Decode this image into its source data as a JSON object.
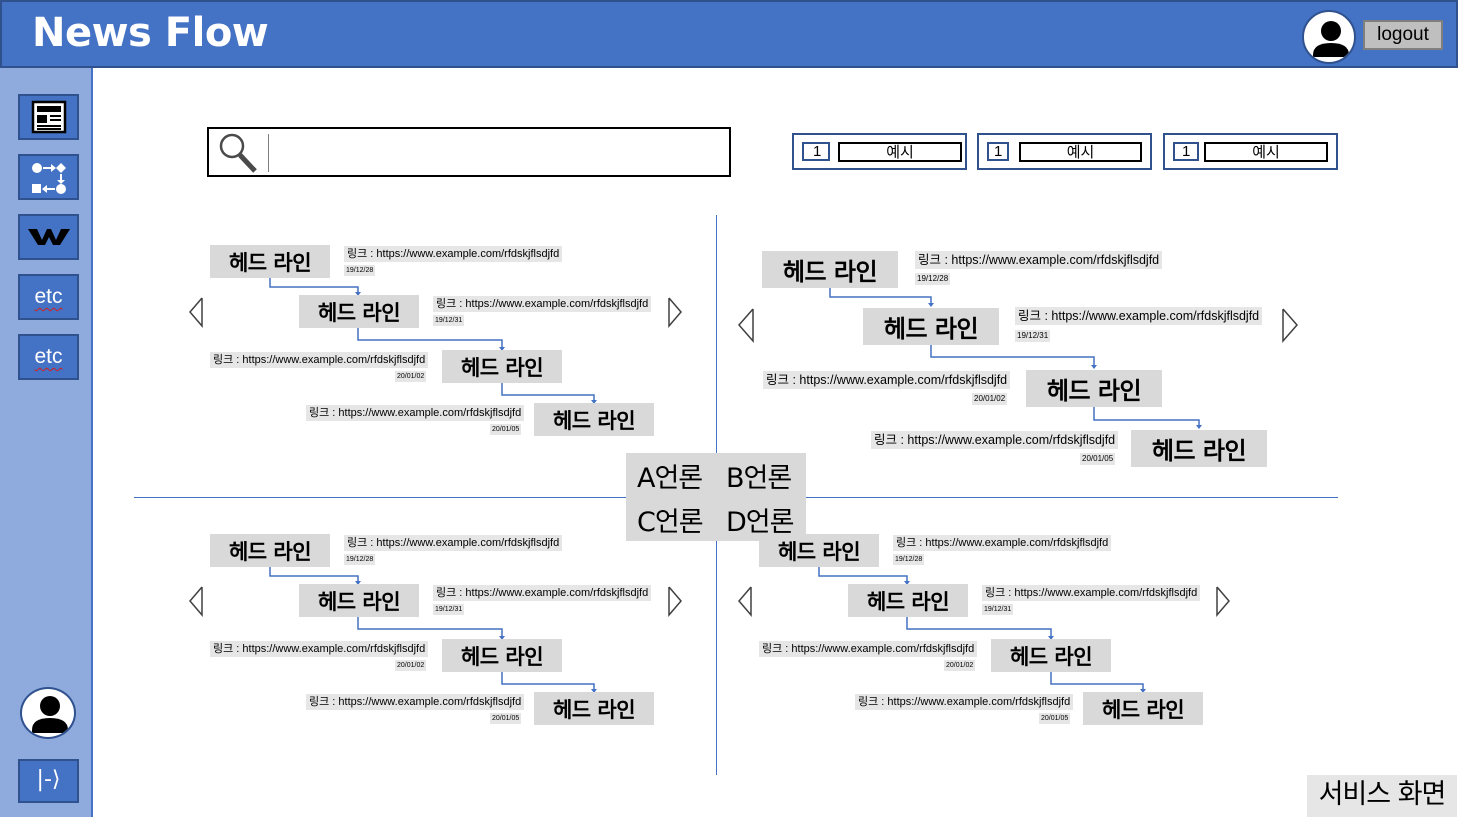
{
  "app": {
    "title": "News Flow",
    "logout_label": "logout"
  },
  "sidebar": {
    "items": [
      {
        "name": "news-icon",
        "label": ""
      },
      {
        "name": "flow-icon",
        "label": ""
      },
      {
        "name": "w-logo-icon",
        "label": ""
      },
      {
        "name": "etc-1",
        "label": "etc"
      },
      {
        "name": "etc-2",
        "label": "etc"
      }
    ],
    "exit_label": "|-⟩"
  },
  "search": {
    "placeholder": "",
    "value": ""
  },
  "filters": [
    {
      "number": "1",
      "label": "예시"
    },
    {
      "number": "1",
      "label": "예시"
    },
    {
      "number": "1",
      "label": "예시"
    }
  ],
  "media": {
    "a": "A언론",
    "b": "B언론",
    "c": "C언론",
    "d": "D언론"
  },
  "quadrants": [
    {
      "items": [
        {
          "headline": "헤드 라인",
          "link": "링크 : https://www.example.com/rfdskjflsdjfd",
          "date": "19/12/28"
        },
        {
          "headline": "헤드 라인",
          "link": "링크 : https://www.example.com/rfdskjflsdjfd",
          "date": "19/12/31"
        },
        {
          "headline": "헤드 라인",
          "link": "링크 : https://www.example.com/rfdskjflsdjfd",
          "date": "20/01/02"
        },
        {
          "headline": "헤드 라인",
          "link": "링크 : https://www.example.com/rfdskjflsdjfd",
          "date": "20/01/05"
        }
      ]
    },
    {
      "items": [
        {
          "headline": "헤드 라인",
          "link": "링크 : https://www.example.com/rfdskjflsdjfd",
          "date": "19/12/28"
        },
        {
          "headline": "헤드 라인",
          "link": "링크 : https://www.example.com/rfdskjflsdjfd",
          "date": "19/12/31"
        },
        {
          "headline": "헤드 라인",
          "link": "링크 : https://www.example.com/rfdskjflsdjfd",
          "date": "20/01/02"
        },
        {
          "headline": "헤드 라인",
          "link": "링크 : https://www.example.com/rfdskjflsdjfd",
          "date": "20/01/05"
        }
      ]
    },
    {
      "items": [
        {
          "headline": "헤드 라인",
          "link": "링크 : https://www.example.com/rfdskjflsdjfd",
          "date": "19/12/28"
        },
        {
          "headline": "헤드 라인",
          "link": "링크 : https://www.example.com/rfdskjflsdjfd",
          "date": "19/12/31"
        },
        {
          "headline": "헤드 라인",
          "link": "링크 : https://www.example.com/rfdskjflsdjfd",
          "date": "20/01/02"
        },
        {
          "headline": "헤드 라인",
          "link": "링크 : https://www.example.com/rfdskjflsdjfd",
          "date": "20/01/05"
        }
      ]
    },
    {
      "items": [
        {
          "headline": "헤드 라인",
          "link": "링크 : https://www.example.com/rfdskjflsdjfd",
          "date": "19/12/28"
        },
        {
          "headline": "헤드 라인",
          "link": "링크 : https://www.example.com/rfdskjflsdjfd",
          "date": "19/12/31"
        },
        {
          "headline": "헤드 라인",
          "link": "링크 : https://www.example.com/rfdskjflsdjfd",
          "date": "20/01/02"
        },
        {
          "headline": "헤드 라인",
          "link": "링크 : https://www.example.com/rfdskjflsdjfd",
          "date": "20/01/05"
        }
      ]
    }
  ],
  "footer": {
    "service_label": "서비스 화면"
  }
}
